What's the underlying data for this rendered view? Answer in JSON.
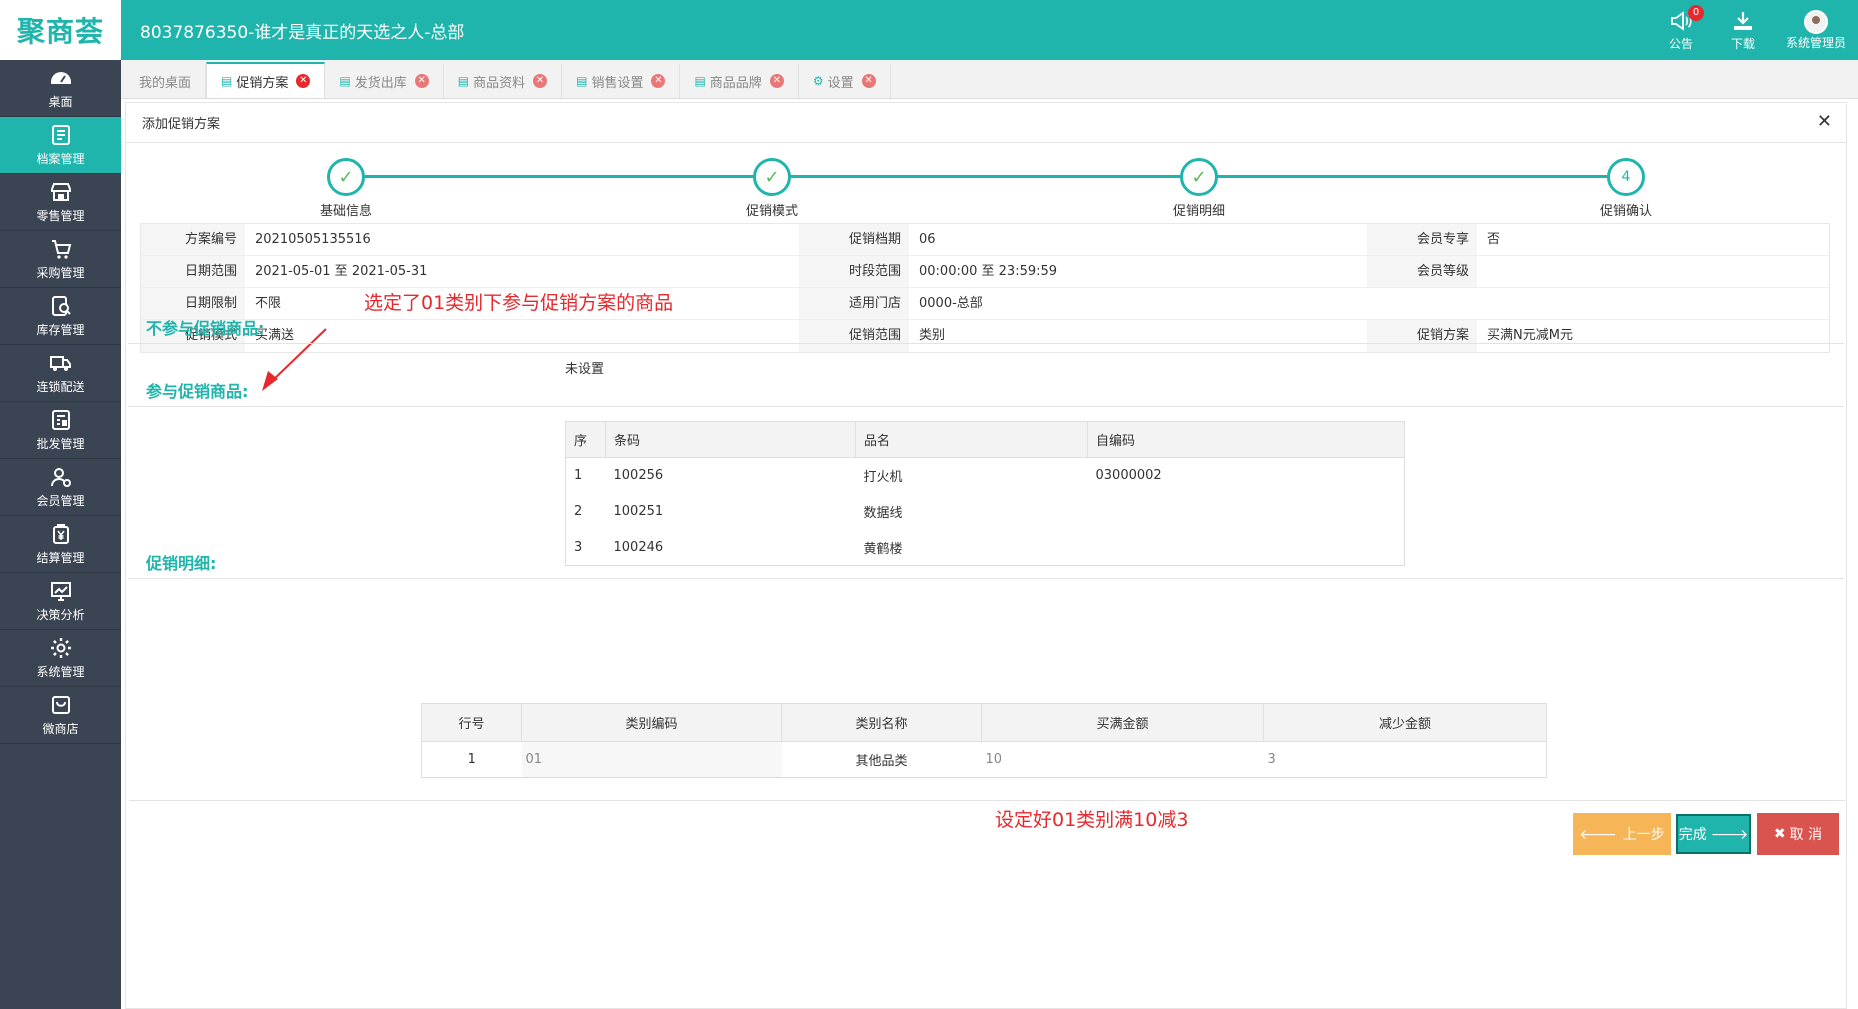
{
  "app": {
    "logo": "聚商荟",
    "title": "8037876350-谁才是真正的天选之人-总部"
  },
  "top_actions": [
    {
      "label": "公告",
      "badge": "0",
      "icon": "megaphone-icon"
    },
    {
      "label": "下载",
      "icon": "download-icon"
    },
    {
      "label": "系统管理员",
      "icon": "avatar-icon"
    }
  ],
  "sidebar": {
    "items": [
      {
        "label": "桌面",
        "icon": "dashboard-icon"
      },
      {
        "label": "档案管理",
        "icon": "archive-icon",
        "active": true
      },
      {
        "label": "零售管理",
        "icon": "store-icon"
      },
      {
        "label": "采购管理",
        "icon": "cart-icon"
      },
      {
        "label": "库存管理",
        "icon": "inventory-icon"
      },
      {
        "label": "连锁配送",
        "icon": "truck-icon"
      },
      {
        "label": "批发管理",
        "icon": "wholesale-icon"
      },
      {
        "label": "会员管理",
        "icon": "member-icon"
      },
      {
        "label": "结算管理",
        "icon": "yen-icon"
      },
      {
        "label": "决策分析",
        "icon": "chart-icon"
      },
      {
        "label": "系统管理",
        "icon": "gear-icon"
      },
      {
        "label": "微商店",
        "icon": "bag-icon"
      }
    ]
  },
  "tabs": [
    {
      "label": "我的桌面",
      "closable": false
    },
    {
      "label": "促销方案",
      "closable": true,
      "active": true
    },
    {
      "label": "发货出库",
      "closable": true
    },
    {
      "label": "商品资料",
      "closable": true
    },
    {
      "label": "销售设置",
      "closable": true
    },
    {
      "label": "商品品牌",
      "closable": true
    },
    {
      "label": "设置",
      "closable": true
    }
  ],
  "panel": {
    "title": "添加促销方案"
  },
  "steps": [
    {
      "label": "基础信息",
      "done": true
    },
    {
      "label": "促销模式",
      "done": true
    },
    {
      "label": "促销明细",
      "done": true
    },
    {
      "label": "促销确认",
      "num": "4"
    }
  ],
  "info": {
    "rows": [
      [
        {
          "l": "方案编号",
          "v": "20210505135516"
        },
        {
          "l": "促销档期",
          "v": "06"
        },
        {
          "l": "会员专享",
          "v": "否"
        }
      ],
      [
        {
          "l": "日期范围",
          "v": "2021-05-01 至 2021-05-31"
        },
        {
          "l": "时段范围",
          "v": "00:00:00 至 23:59:59"
        },
        {
          "l": "会员等级",
          "v": ""
        }
      ],
      [
        {
          "l": "日期限制",
          "v": "不限"
        },
        {
          "l": "适用门店",
          "v": "0000-总部"
        },
        {
          "l": "",
          "v": ""
        }
      ],
      [
        {
          "l": "促销模式",
          "v": "买满送"
        },
        {
          "l": "促销范围",
          "v": "类别"
        },
        {
          "l": "促销方案",
          "v": "买满N元减M元"
        }
      ]
    ]
  },
  "sections": {
    "exclude_title": "不参与促销商品:",
    "not_set": "未设置",
    "include_title": "参与促销商品:",
    "detail_title": "促销明细:"
  },
  "annotations": {
    "top": "选定了01类别下参与促销方案的商品",
    "bottom": "设定好01类别满10减3"
  },
  "products": {
    "headers": [
      "序",
      "条码",
      "品名",
      "自编码"
    ],
    "rows": [
      [
        "1",
        "100256",
        "打火机",
        "03000002"
      ],
      [
        "2",
        "100251",
        "数据线",
        ""
      ],
      [
        "3",
        "100246",
        "黄鹤楼",
        ""
      ]
    ]
  },
  "details": {
    "headers": [
      "行号",
      "类别编码",
      "类别名称",
      "买满金额",
      "减少金额"
    ],
    "rows": [
      [
        "1",
        "01",
        "其他品类",
        "10",
        "3"
      ]
    ]
  },
  "buttons": {
    "prev": "上一步",
    "done": "完成",
    "cancel": "取 消"
  },
  "colors": {
    "primary": "#1fb5ac",
    "sidebar": "#3b4452",
    "danger": "#d9534f",
    "warning": "#f6b557",
    "annotation": "#e8282c"
  }
}
